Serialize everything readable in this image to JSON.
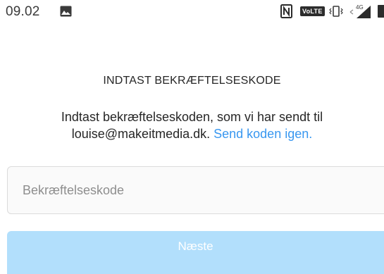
{
  "status_bar": {
    "time": "09.02",
    "network_badge": "VoLTE",
    "network_type": "4G",
    "icons": [
      "gallery-icon",
      "nfc-icon",
      "volte-icon",
      "vibrate-icon",
      "signal-icon",
      "battery-icon"
    ]
  },
  "verification": {
    "title": "INDTAST BEKRÆFTELSESKODE",
    "instructions_line1": "Indtast bekræftelseskoden, som vi har sendt til",
    "email": "louise@makeitmedia.dk.",
    "resend_link": "Send koden igen.",
    "code_input": {
      "placeholder": "Bekræftelseskode",
      "value": ""
    },
    "next_button": "Næste"
  },
  "colors": {
    "link": "#3897f0",
    "button_disabled": "#b2dffc",
    "input_border": "#dbdbdb",
    "input_background": "#fafafa",
    "text": "#262626"
  }
}
